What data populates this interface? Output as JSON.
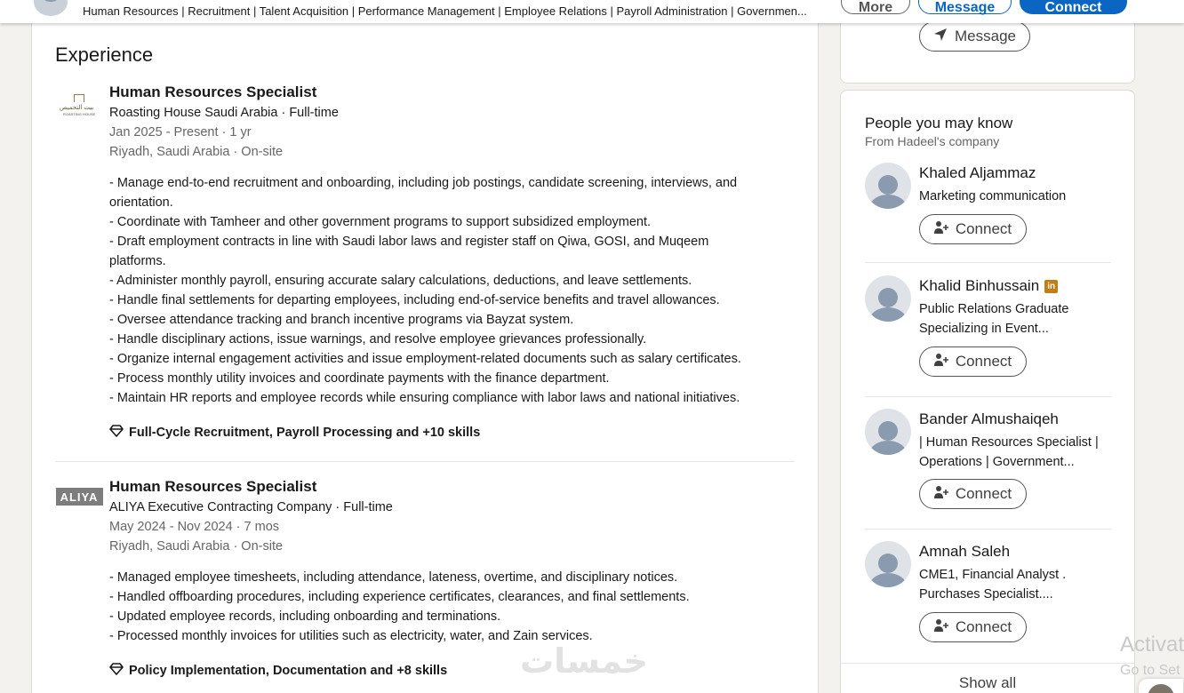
{
  "topbar": {
    "headline": "Human Resources | Recruitment | Talent Acquisition | Performance Management | Employee Relations | Payroll Administration | Governmen...",
    "more_label": "More",
    "message_label": "Message",
    "connect_label": "Connect"
  },
  "experience": {
    "section_title": "Experience",
    "items": [
      {
        "logo_text_ar": "بيت التحميص",
        "logo_text_en": "ROASTING HOUSE",
        "title": "Human Resources Specialist",
        "company": "Roasting House Saudi Arabia · Full-time",
        "dates": "Jan 2025 - Present · 1 yr",
        "location": "Riyadh, Saudi Arabia · On-site",
        "description": [
          "- Manage end-to-end recruitment and onboarding, including job postings, candidate screening, interviews, and",
          "orientation.",
          "- Coordinate with Tamheer and other government programs to support subsidized employment.",
          "- Draft employment contracts in line with Saudi labor laws and register staff on Qiwa, GOSI, and Muqeem",
          "platforms.",
          "- Administer monthly payroll, ensuring accurate salary calculations, deductions, and leave settlements.",
          "- Handle final settlements for departing employees, including end-of-service benefits and travel allowances.",
          "- Oversee attendance tracking and branch incentive programs via Bayzat system.",
          "- Handle disciplinary actions, issue warnings, and resolve employee grievances professionally.",
          "- Organize internal engagement activities and issue employment-related documents such as salary certificates.",
          "- Process monthly utility invoices and coordinate payments with the finance department.",
          "- Maintain HR reports and employee records while ensuring compliance with labor laws and national initiatives."
        ],
        "skills": "Full-Cycle Recruitment, Payroll Processing and +10 skills"
      },
      {
        "logo_text": "ALIYA",
        "title": "Human Resources Specialist",
        "company": "ALIYA Executive Contracting Company · Full-time",
        "dates": "May 2024 - Nov 2024 · 7 mos",
        "location": "Riyadh, Saudi Arabia · On-site",
        "description": [
          "- Managed employee timesheets, including attendance, lateness, overtime, and disciplinary notices.",
          "- Handled offboarding procedures, including experience certificates, clearances, and final settlements.",
          "- Updated employee records, including onboarding and terminations.",
          "- Processed monthly invoices for utilities such as electricity, water, and Zain services."
        ],
        "skills": "Policy Implementation, Documentation and +8 skills"
      }
    ]
  },
  "sidebar": {
    "message_label": "Message",
    "pymk_title": "People you may know",
    "pymk_subtitle": "From Hadeel's company",
    "connect_label": "Connect",
    "people": [
      {
        "name": "Khaled Aljammaz",
        "headline": "Marketing communication",
        "premium": false
      },
      {
        "name": "Khalid Binhussain",
        "headline": "Public Relations Graduate Specializing in Event...",
        "premium": true
      },
      {
        "name": "Bander Almushaiqeh",
        "headline": "| Human Resources Specialist | Operations | Government...",
        "premium": false
      },
      {
        "name": "Amnah Saleh",
        "headline": "CME1, Financial Analyst . Purchases Specialist....",
        "premium": false
      }
    ],
    "show_all_label": "Show all"
  },
  "overlays": {
    "watermark": "خمسات",
    "activate_title": "Activat",
    "activate_sub": "Go to Set"
  },
  "colors": {
    "brand_blue": "#0a66c2",
    "page_bg": "#f4f2ee",
    "premium_gold": "#c37d16"
  }
}
